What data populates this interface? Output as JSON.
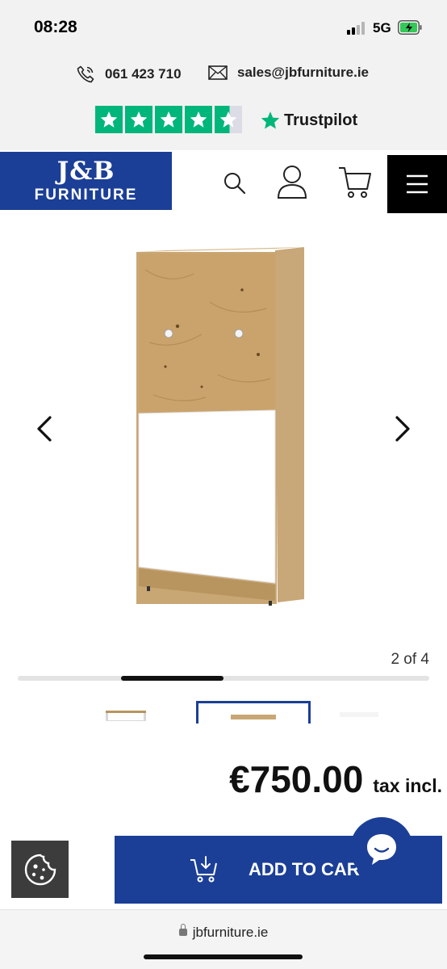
{
  "status_bar": {
    "time": "08:28",
    "network": "5G",
    "icons": [
      "signal-icon",
      "battery-charging-icon"
    ]
  },
  "contact": {
    "phone": "061 423 710",
    "email": "sales@jbfurniture.ie",
    "icons": [
      "phone-icon",
      "mail-icon"
    ]
  },
  "trustpilot": {
    "brand": "Trustpilot",
    "rating_stars": 4.5,
    "star_color": "#00b67a"
  },
  "header": {
    "logo_top": "J&B",
    "logo_bottom": "FURNITURE",
    "brand_color": "#1b3f97",
    "icons": [
      "search-icon",
      "account-icon",
      "cart-icon",
      "menu-icon"
    ]
  },
  "gallery": {
    "counter": "2 of 4",
    "current_index": 2,
    "total": 4,
    "icons": [
      "chevron-left-icon",
      "chevron-right-icon"
    ]
  },
  "product": {
    "price": "€750.00",
    "tax_label": "tax incl."
  },
  "actions": {
    "add_to_cart_label": "ADD TO CAR",
    "icons": [
      "cookie-icon",
      "cart-download-icon",
      "chat-icon"
    ]
  },
  "browser": {
    "url": "jbfurniture.ie"
  }
}
